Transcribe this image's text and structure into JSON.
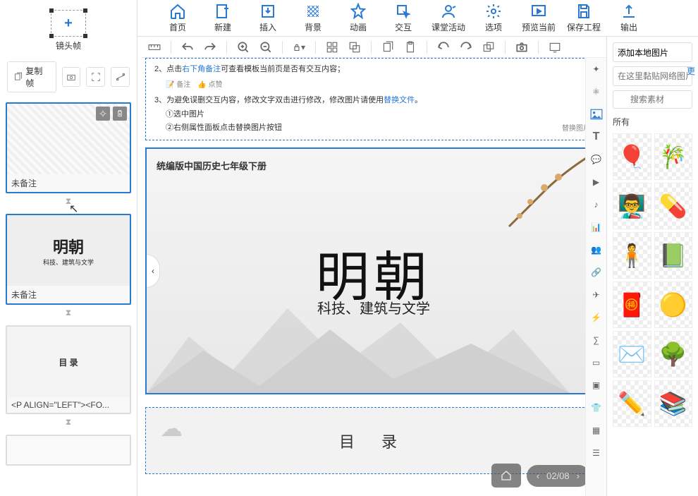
{
  "toolbar": {
    "home": "首页",
    "new": "新建",
    "insert": "插入",
    "background": "背景",
    "animation": "动画",
    "interaction": "交互",
    "classroom": "课堂活动",
    "options": "选项",
    "preview": "预览当前",
    "save": "保存工程",
    "export": "输出"
  },
  "left": {
    "lens_label": "镜头帧",
    "copy_frame": "复制帧",
    "thumbs": [
      {
        "label": "未备注"
      },
      {
        "label": "未备注",
        "big": "明朝",
        "small": "科技、建筑与文学"
      },
      {
        "label": "<P ALIGN=\"LEFT\"><FO...",
        "ml": "目 录"
      }
    ]
  },
  "instructions": {
    "line2_prefix": "2、点击",
    "line2_blue": "右下角备注",
    "line2_suffix": "可查看模板当前页是否有交互内容；",
    "icons": [
      "备注",
      "点赞"
    ],
    "line3_prefix": "3、为避免误删交互内容，修改文字双击进行修改，修改图片请使用",
    "line3_blue": "替换文件",
    "line3_suffix": "。",
    "sub1": "①选中图片",
    "sub2": "②右侧属性面板点击替换图片按钮",
    "bot": "替换图片"
  },
  "canvas": {
    "subtitle": "统编版中国历史七年级下册",
    "title": "明朝",
    "subtitle2": "科技、建筑与文学",
    "mulu": "目 录"
  },
  "pager": {
    "text": "02/08"
  },
  "right": {
    "add_local": "添加本地图片",
    "paste_placeholder": "在这里黏贴网络图片",
    "search_placeholder": "搜索素材",
    "all": "所有",
    "more": "更"
  }
}
